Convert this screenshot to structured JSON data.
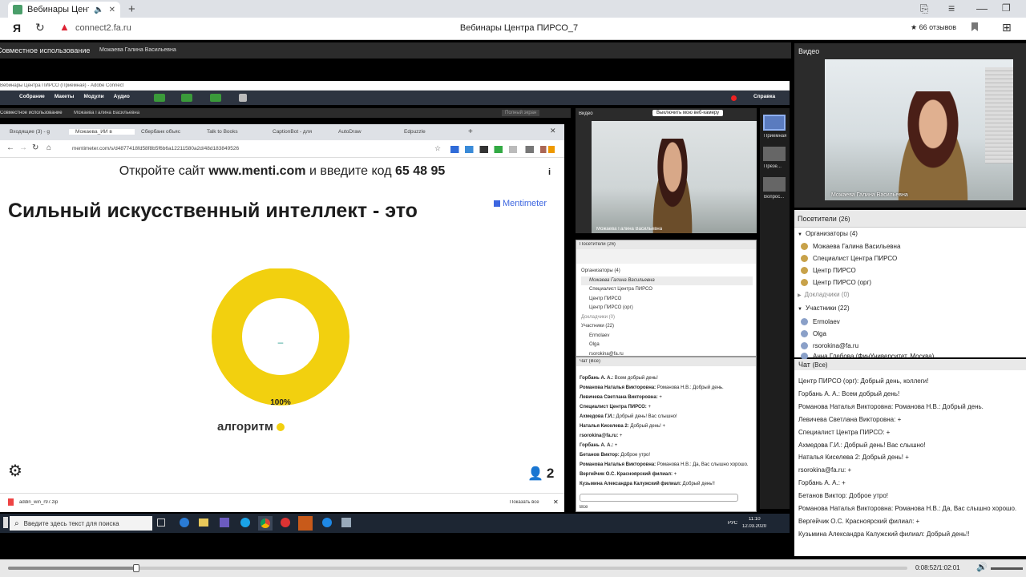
{
  "browser": {
    "tab_title": "Вебинары Центра П",
    "url": "connect2.fa.ru",
    "page_title": "Вебинары Центра ПИРСО_7",
    "reviews": "★ 66 отзывов"
  },
  "ac": {
    "share_title": "Совместное использование",
    "presenter": "Можаева Галина Васильевна",
    "video_title": "Видео",
    "video_name": "Можаева Галина Васильевна",
    "attendees_title": "Посетители",
    "attendees_count": "(26)",
    "groups": {
      "org": "Организаторы (4)",
      "pres": "Докладчики (0)",
      "part": "Участники (22)"
    },
    "orgs": [
      "Можаева Галина Васильевна",
      "Специалист Центра ПИРСО",
      "Центр ПИРСО",
      "Центр ПИРСО (орг)"
    ],
    "parts": [
      "Ermolaev",
      "Olga",
      "rsorokina@fa.ru",
      "Анна Глебова (ФинУниверситет, Москва)"
    ],
    "chat_title": "Чат",
    "chat_scope": "(Все)",
    "chat": [
      {
        "n": "Центр ПИРСО (орг):",
        "t": "Добрый день, коллеги!"
      },
      {
        "n": "Горбань А. А.:",
        "t": "Всем добрый день!"
      },
      {
        "n": "Романова Наталья Викторовна:",
        "t": "Романова Н.В.: Добрый день."
      },
      {
        "n": "Левичева Светлана Викторовна:",
        "t": "+"
      },
      {
        "n": "Специалист Центра ПИРСО:",
        "t": "+"
      },
      {
        "n": "Ахмедова Г.И.:",
        "t": "Добрый день! Вас слышно!"
      },
      {
        "n": "Наталья Киселева 2:",
        "t": "Добрый день! +"
      },
      {
        "n": "rsorokina@fa.ru:",
        "t": "+"
      },
      {
        "n": "Горбань А. А.:",
        "t": "+"
      },
      {
        "n": "Бетанов Виктор:",
        "t": "Доброе утро!"
      },
      {
        "n": "Романова Наталья Викторовна:",
        "t": "Романова Н.В.: Да, Вас слышно хорошо."
      },
      {
        "n": "Вергейчик О.С. Красноярский филиал:",
        "t": "+"
      },
      {
        "n": "Кузьмина Александра Калужский филиал:",
        "t": "Добрый день!!"
      }
    ],
    "player": {
      "time": "0:08:52/1:02:01",
      "progress": 0.143
    }
  },
  "inner": {
    "window_title": "Вебинары Центра ПИРСО (Приемная) - Adobe Connect",
    "menu": [
      "Собрание",
      "Макеты",
      "Модули",
      "Аудио"
    ],
    "help": "Справка",
    "full_btn": "Полный экран",
    "video_title": "Видео",
    "stop_cam": "Выключить мою веб-камеру",
    "chat_scope": "(Все)",
    "chat_to": "Все",
    "side": [
      "Приемная",
      "Презе...",
      "Вопрос..."
    ],
    "inner_chat": [
      {
        "n": "Горбань А. А.:",
        "t": "Всем добрый день!"
      },
      {
        "n": "Романова Наталья Викторовна:",
        "t": "Романова Н.В.: Добрый день."
      },
      {
        "n": "Левичева Светлана Викторовна:",
        "t": "+"
      },
      {
        "n": "Специалист Центра ПИРСО:",
        "t": "+"
      },
      {
        "n": "Ахмедова Г.И.:",
        "t": "Добрый день! Вас слышно!"
      },
      {
        "n": "Наталья Киселева 2:",
        "t": "Добрый день! +"
      },
      {
        "n": "rsorokina@fa.ru:",
        "t": "+"
      },
      {
        "n": "Горбань А. А.:",
        "t": "+"
      },
      {
        "n": "Бетанов Виктор:",
        "t": "Доброе утро!"
      },
      {
        "n": "Романова Наталья Викторовна:",
        "t": "Романова Н.В.: Да, Вас слышно хорошо."
      },
      {
        "n": "Вергейчик О.С. Красноярский филиал:",
        "t": "+"
      },
      {
        "n": "Кузьмина Александра Калужский филиал:",
        "t": "Добрый день!!"
      }
    ]
  },
  "chrome": {
    "tabs": [
      "Входящие (3) - g",
      "Можаева_ИИ в",
      "Сбербанк объяс",
      "Talk to Books",
      "CaptionBot - для",
      "AutoDraw",
      "Edpuzzle"
    ],
    "url": "mentimeter.com/s/d4877418fd58f8b5f6b6a12211580a2d/48d183849526",
    "download": "addin_win_r97.zip",
    "show_all": "Показать все"
  },
  "menti": {
    "header_a": "Откройте сайт",
    "site": "www.menti.com",
    "header_b": "и введите код",
    "code": "65 48 95",
    "title": "Сильный искусственный интеллект - это",
    "brand": "Mentimeter",
    "pct": "100%",
    "answer": "алгоритм",
    "participants": "2"
  },
  "chart_data": {
    "type": "pie",
    "categories": [
      "алгоритм"
    ],
    "values": [
      100
    ],
    "labels": [
      "100%"
    ]
  },
  "taskbar": {
    "search": "Введите здесь текст для поиска",
    "lang": "РУС",
    "time": "11:10",
    "date": "12.03.2020"
  },
  "colors": {
    "accent": "#f2d00f",
    "ac_bar": "#1f2b3a",
    "menti_blue": "#3d66e0"
  }
}
